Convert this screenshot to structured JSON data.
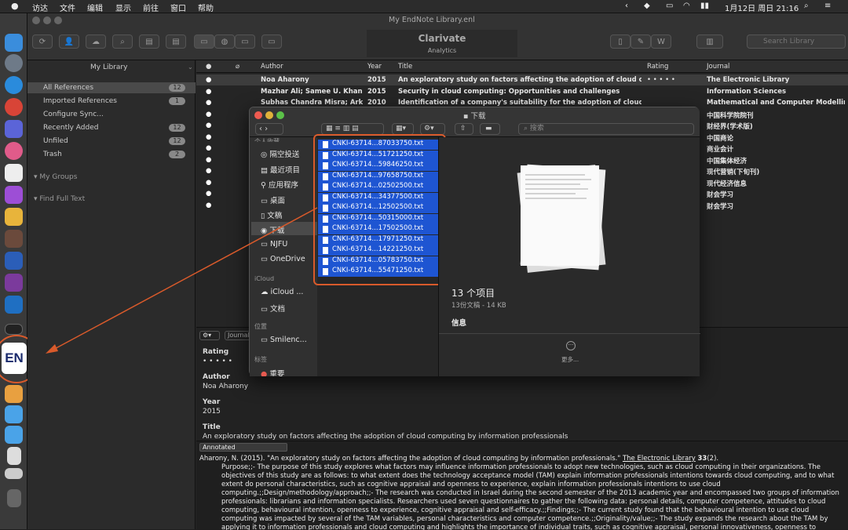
{
  "menubar": {
    "apple": "",
    "items": [
      "访达",
      "文件",
      "编辑",
      "显示",
      "前往",
      "窗口",
      "帮助"
    ],
    "clock": "1月12日 周日 21:16"
  },
  "window": {
    "title": "My EndNote Library.enl"
  },
  "clarivate": {
    "name": "Clarivate",
    "sub": "Analytics"
  },
  "search": {
    "placeholder": "Search Library"
  },
  "sidebar": {
    "header": "My Library",
    "items": [
      {
        "label": "All References",
        "count": "12"
      },
      {
        "label": "Imported References",
        "count": "1"
      },
      {
        "label": "Configure Sync...",
        "count": ""
      },
      {
        "label": "Recently Added",
        "count": "12"
      },
      {
        "label": "Unfiled",
        "count": "12"
      },
      {
        "label": "Trash",
        "count": "2"
      }
    ],
    "groups": "My Groups",
    "fulltext": "Find Full Text"
  },
  "table": {
    "headers": {
      "author": "Author",
      "year": "Year",
      "title": "Title",
      "rating": "Rating",
      "journal": "Journal"
    },
    "rows": [
      {
        "author": "Noa Aharony",
        "year": "2015",
        "title": "An exploratory study on factors affecting the adoption of cloud compu...",
        "rating": "• • • • •",
        "journal": "The Electronic Library"
      },
      {
        "author": "Mazhar Ali; Samee U. Khan;...",
        "year": "2015",
        "title": "Security in cloud computing: Opportunities and challenges",
        "rating": "",
        "journal": "Information Sciences"
      },
      {
        "author": "Subhas Chandra Misra; Ark...",
        "year": "2010",
        "title": "Identification of a company's suitability for the adoption of cloud com...",
        "rating": "",
        "journal": "Mathematical and Computer Modelling"
      },
      {
        "author": "",
        "year": "",
        "title": "",
        "rating": "",
        "journal": "中国科学院院刊"
      },
      {
        "author": "",
        "year": "",
        "title": "",
        "rating": "",
        "journal": "财经界(学术版)"
      },
      {
        "author": "",
        "year": "",
        "title": "",
        "rating": "",
        "journal": "中国商论"
      },
      {
        "author": "",
        "year": "",
        "title": "",
        "rating": "",
        "journal": "商业会计"
      },
      {
        "author": "",
        "year": "",
        "title": "",
        "rating": "",
        "journal": "中国集体经济"
      },
      {
        "author": "",
        "year": "",
        "title": "",
        "rating": "",
        "journal": "现代营销(下旬刊)"
      },
      {
        "author": "",
        "year": "",
        "title": "",
        "rating": "",
        "journal": "现代经济信息"
      },
      {
        "author": "",
        "year": "",
        "title": "",
        "rating": "",
        "journal": "财会学习"
      },
      {
        "author": "",
        "year": "",
        "title": "",
        "rating": "",
        "journal": "财会学习"
      }
    ]
  },
  "preview": {
    "tab": "Journal",
    "rating_label": "Rating",
    "rating_value": "• • • • •",
    "author_label": "Author",
    "author_value": "Noa Aharony",
    "year_label": "Year",
    "year_value": "2015",
    "title_label": "Title",
    "title_value": "An exploratory study on factors affecting the adoption of cloud computing by information professionals"
  },
  "annotated": {
    "select": "Annotated",
    "citation": "Aharony, N. (2015). \"An exploratory study on factors affecting the adoption of cloud computing by information professionals.\"",
    "journal": "The Electronic Library",
    "volume": "33",
    "issue": "(2).",
    "abstract": "Purpose;;- The purpose of this study explores what factors may influence information professionals to adopt new technologies, such as cloud computing in their organizations. The objectives of this study are as follows: to what extent does the technology acceptance model (TAM) explain information professionals intentions towards cloud computing, and to what extent do personal characteristics, such as cognitive appraisal and openness to experience, explain information professionals intentions to use cloud computing.;;Design/methodology/approach;;- The research was conducted in Israel during the second semester of the 2013 academic year and encompassed two groups of information professionals: librarians and information specialists. Researchers used seven questionnaires to gather the following data: personal details, computer competence, attitudes to cloud computing, behavioural intention, openness to experience, cognitive appraisal and self-efficacy.;;Findings;;- The current study found that the behavioural intention to use cloud computing was impacted by several of the TAM variables, personal characteristics and computer competence.;;Originality/value;;- The study expands the research about the TAM by applying it to information professionals and cloud computing and highlights the importance of individual traits, such as cognitive appraisal, personal innovativeness, openness to experience and computer competence when considering technology acceptance. Further, the current study proposes that if directors of information organizations"
  },
  "finder": {
    "title": "下载",
    "search_placeholder": "搜索",
    "sidebar": {
      "favorites_header": "个人收藏",
      "favorites": [
        "隔空投送",
        "最近项目",
        "应用程序",
        "桌面",
        "文稿",
        "下载",
        "NJFU",
        "OneDrive"
      ],
      "icloud_header": "iCloud",
      "icloud": [
        "iCloud ...",
        "文档"
      ],
      "locations_header": "位置",
      "locations": [
        "Smilenc..."
      ],
      "tags_header": "标签",
      "tags": [
        "重要"
      ]
    },
    "files": [
      "CNKI-63714...87033750.txt",
      "CNKI-63714...51721250.txt",
      "CNKI-63714...59846250.txt",
      "CNKI-63714...97658750.txt",
      "CNKI-63714...02502500.txt",
      "CNKI-63714...34377500.txt",
      "CNKI-63714...12502500.txt",
      "CNKI-63714...50315000.txt",
      "CNKI-63714...17502500.txt",
      "CNKI-63714...17971250.txt",
      "CNKI-63714...14221250.txt",
      "CNKI-63714...05783750.txt",
      "CNKI-63714...55471250.txt"
    ],
    "info": {
      "count": "13 个项目",
      "detail": "13份文稿 - 14 KB",
      "section": "信息",
      "more": "更多..."
    }
  },
  "dock": {
    "en_label": "EN"
  },
  "colors": {
    "highlight": "#1e55d2",
    "annotation": "#d95a2b",
    "menubar": "#2c2c2c"
  }
}
